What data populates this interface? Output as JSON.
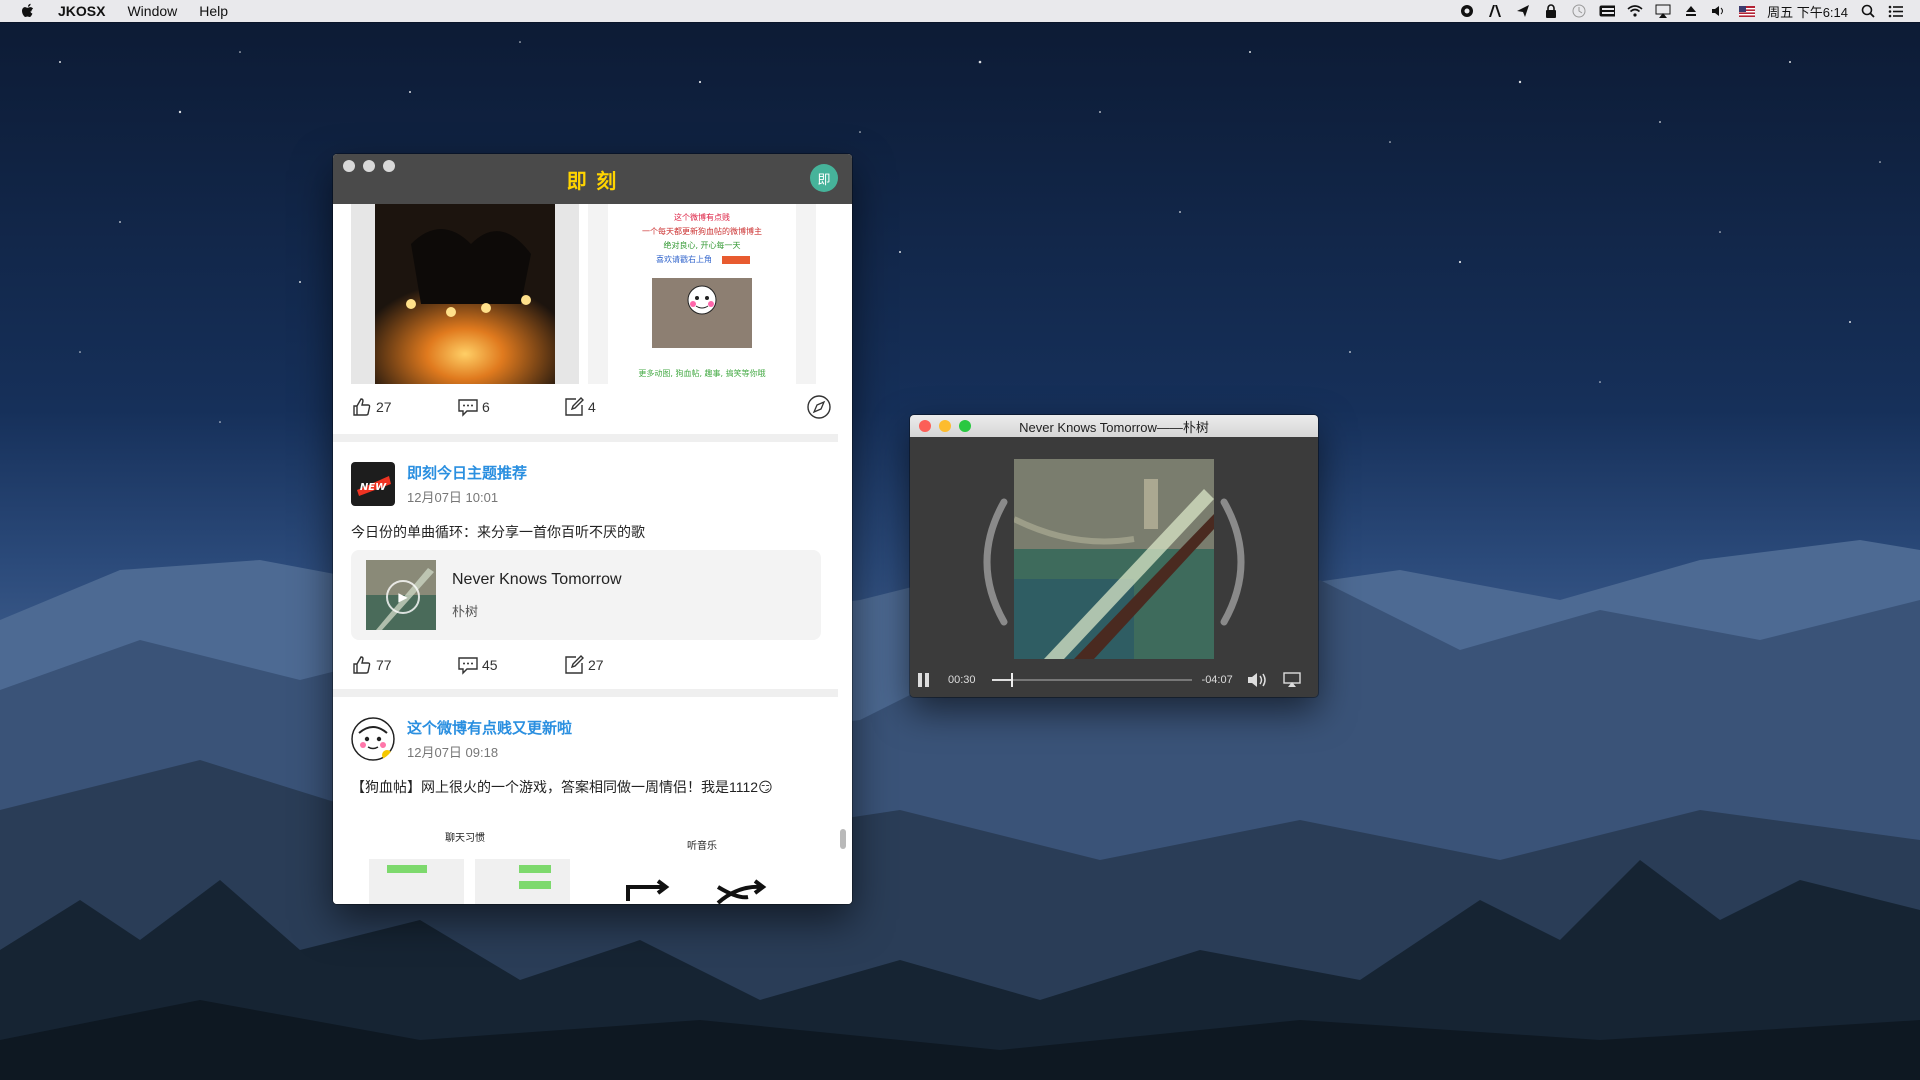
{
  "menubar": {
    "apple_icon": "apple-logo-icon",
    "app_name": "JKOSX",
    "menus": [
      "Window",
      "Help"
    ],
    "clock": "周五 下午6:14"
  },
  "jike": {
    "title": "即 刻",
    "avatar_text": "即",
    "post1": {
      "likes": "27",
      "comments": "6",
      "reposts": "4",
      "thumb2_lines": [
        "这个微博有点贱",
        "一个每天都更新狗血帖的微博博主",
        "绝对良心, 开心每一天",
        "喜欢请戳右上角"
      ],
      "thumb2_caption": "更多动图, 狗血帖, 趣事, 搞笑等你哦"
    },
    "post2": {
      "author": "即刻今日主题推荐",
      "avatar_text": "NEW",
      "time": "12月07日 10:01",
      "text": "今日份的单曲循环：来分享一首你百听不厌的歌",
      "music_title": "Never Knows Tomorrow",
      "music_artist": "朴树",
      "likes": "77",
      "comments": "45",
      "reposts": "27"
    },
    "post3": {
      "author": "这个微博有点贱又更新啦",
      "time": "12月07日 09:18",
      "text": "【狗血帖】网上很火的一个游戏，答案相同做一周情侣！我是1112😏",
      "preview_left": "聊天习惯",
      "preview_right": "听音乐"
    }
  },
  "player": {
    "title": "Never Knows Tomorrow——朴树",
    "elapsed": "00:30",
    "remaining": "-04:07",
    "progress": 0.1
  },
  "colors": {
    "accent_yellow": "#ffd400",
    "link_blue": "#2a8fe0",
    "titlebar_dark": "#4a4a4a",
    "player_bg": "#3b3b3b"
  }
}
